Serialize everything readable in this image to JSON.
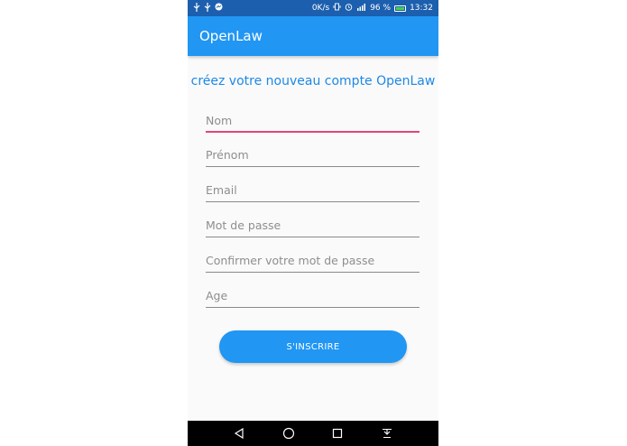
{
  "status_bar": {
    "network_speed": "0K/s",
    "battery_percent": "96 %",
    "time": "13:32",
    "left_icons": [
      "usb-icon",
      "usb-icon",
      "messenger-icon"
    ],
    "right_icons": [
      "vibrate-icon",
      "alarm-icon",
      "signal-icon",
      "battery-icon"
    ]
  },
  "app_bar": {
    "title": "OpenLaw",
    "color": "#2196f3"
  },
  "form": {
    "heading": "créez votre nouveau compte OpenLaw",
    "fields": {
      "nom": {
        "placeholder": "Nom",
        "value": ""
      },
      "prenom": {
        "placeholder": "Prénom",
        "value": ""
      },
      "email": {
        "placeholder": "Email",
        "value": ""
      },
      "password": {
        "placeholder": "Mot de passe",
        "value": ""
      },
      "confirm": {
        "placeholder": "Confirmer votre mot de passe",
        "value": ""
      },
      "age": {
        "placeholder": "Age",
        "value": ""
      }
    },
    "submit_label": "S'INSCRIRE",
    "accent_color": "#e0457b"
  },
  "nav_bar": {
    "icons": [
      "back-icon",
      "home-icon",
      "recents-icon",
      "notification-pull-icon"
    ]
  }
}
